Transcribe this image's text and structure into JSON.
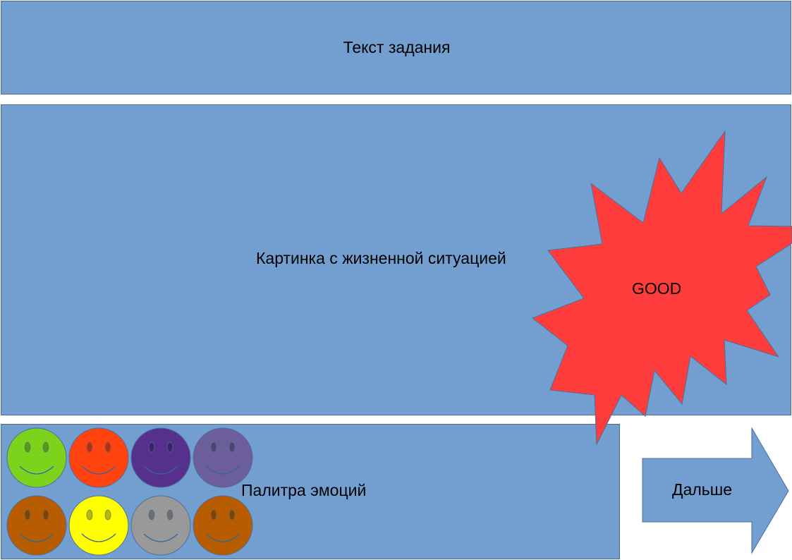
{
  "task": {
    "label": "Текст задания"
  },
  "picture": {
    "label": "Картинка с жизненной ситуацией"
  },
  "burst": {
    "label": "GOOD"
  },
  "palette": {
    "label": "Палитра эмоций",
    "emotions": [
      {
        "color": "#7dd31c"
      },
      {
        "color": "#ff420e"
      },
      {
        "color": "#55308d"
      },
      {
        "color": "#6b5e9b"
      },
      {
        "color": "#b85c00"
      },
      {
        "color": "#ffff00"
      },
      {
        "color": "#999999"
      },
      {
        "color": "#b85c00"
      }
    ]
  },
  "next_button": {
    "label": "Дальше"
  },
  "colors": {
    "panel": "#729fcf",
    "burst": "#ff3c3c"
  }
}
